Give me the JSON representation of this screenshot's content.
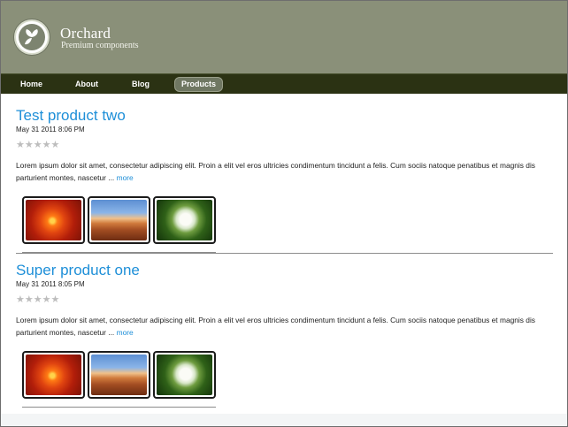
{
  "site": {
    "name": "Orchard",
    "slogan": "Premium components"
  },
  "nav": {
    "items": [
      {
        "label": "Home",
        "active": false
      },
      {
        "label": "About",
        "active": false
      },
      {
        "label": "Blog",
        "active": false
      },
      {
        "label": "Products",
        "active": true
      }
    ]
  },
  "products": [
    {
      "title": "Test product two",
      "date": "May 31 2011 8:06 PM",
      "rating": 0,
      "rating_max": 5,
      "description": "Lorem ipsum dolor sit amet, consectetur adipiscing elit. Proin a elit vel eros ultricies condimentum tincidunt a felis. Cum sociis natoque penatibus et magnis dis parturient montes, nascetur ... ",
      "more_label": "more",
      "images": [
        "red-dahlia-flower",
        "desert-mesa",
        "white-hydrangea"
      ]
    },
    {
      "title": "Super product one",
      "date": "May 31 2011 8:05 PM",
      "rating": 0,
      "rating_max": 5,
      "description": "Lorem ipsum dolor sit amet, consectetur adipiscing elit. Proin a elit vel eros ultricies condimentum tincidunt a felis. Cum sociis natoque penatibus et magnis dis parturient montes, nascetur ... ",
      "more_label": "more",
      "images": [
        "red-dahlia-flower",
        "desert-mesa",
        "white-hydrangea"
      ]
    }
  ],
  "colors": {
    "header_bg": "#8a9079",
    "nav_bg": "#2b3213",
    "link": "#1e8fd8",
    "star_empty": "#bdbdbd"
  }
}
